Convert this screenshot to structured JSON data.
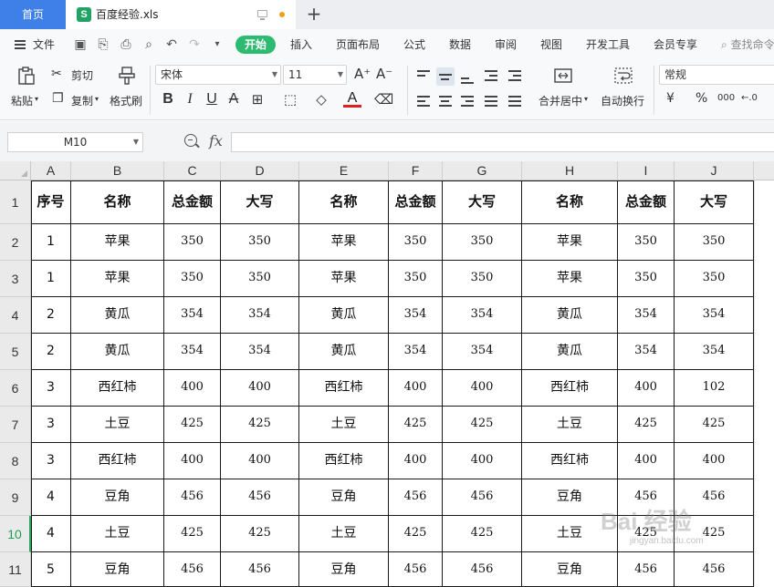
{
  "titlebar": {
    "home_tab": "首页",
    "file_tab": "百度经验.xls",
    "file_icon_letter": "S",
    "new_tab": "+",
    "accent": "#3f7fe8",
    "modified_dot_color": "#f0a020"
  },
  "menu": {
    "file_label": "文件",
    "tabs": [
      "开始",
      "插入",
      "页面布局",
      "公式",
      "数据",
      "审阅",
      "视图",
      "开发工具",
      "会员专享"
    ],
    "active_tab": "开始",
    "active_color": "#2dbb71",
    "search_label": "查找命令"
  },
  "ribbon": {
    "paste": "粘贴",
    "cut": "剪切",
    "copy": "复制",
    "format_painter": "格式刷",
    "font_name": "宋体",
    "font_size": "11",
    "merge_center": "合并居中",
    "wrap_text": "自动换行",
    "number_format": "常规",
    "font_grow": "A⁺",
    "font_shrink": "A⁻",
    "bold": "B",
    "italic": "I",
    "underline": "U",
    "strike": "A",
    "font_color_letter": "A",
    "font_color": "#e02020",
    "currency": "¥",
    "percent": "%",
    "thousands": "000",
    "dec_inc": "←.0"
  },
  "formula_bar": {
    "cell_ref": "M10",
    "fx": "fx",
    "formula": ""
  },
  "sheet": {
    "columns": [
      "A",
      "B",
      "C",
      "D",
      "E",
      "F",
      "G",
      "H",
      "I",
      "J"
    ],
    "row_numbers": [
      "1",
      "2",
      "3",
      "4",
      "5",
      "6",
      "7",
      "8",
      "9",
      "10",
      "11"
    ],
    "active_row": "10",
    "header_row": [
      "序号",
      "名称",
      "总金额",
      "大写",
      "名称",
      "总金额",
      "大写",
      "名称",
      "总金额",
      "大写"
    ],
    "rows": [
      [
        "1",
        "苹果",
        "350",
        "350",
        "苹果",
        "350",
        "350",
        "苹果",
        "350",
        "350"
      ],
      [
        "1",
        "苹果",
        "350",
        "350",
        "苹果",
        "350",
        "350",
        "苹果",
        "350",
        "350"
      ],
      [
        "2",
        "黄瓜",
        "354",
        "354",
        "黄瓜",
        "354",
        "354",
        "黄瓜",
        "354",
        "354"
      ],
      [
        "2",
        "黄瓜",
        "354",
        "354",
        "黄瓜",
        "354",
        "354",
        "黄瓜",
        "354",
        "354"
      ],
      [
        "3",
        "西红柿",
        "400",
        "400",
        "西红柿",
        "400",
        "400",
        "西红柿",
        "400",
        "102"
      ],
      [
        "3",
        "土豆",
        "425",
        "425",
        "土豆",
        "425",
        "425",
        "土豆",
        "425",
        "425"
      ],
      [
        "3",
        "西红柿",
        "400",
        "400",
        "西红柿",
        "400",
        "400",
        "西红柿",
        "400",
        "400"
      ],
      [
        "4",
        "豆角",
        "456",
        "456",
        "豆角",
        "456",
        "456",
        "豆角",
        "456",
        "456"
      ],
      [
        "4",
        "土豆",
        "425",
        "425",
        "土豆",
        "425",
        "425",
        "土豆",
        "425",
        "425"
      ],
      [
        "5",
        "豆角",
        "456",
        "456",
        "豆角",
        "456",
        "456",
        "豆角",
        "456",
        "456"
      ]
    ]
  },
  "watermark": {
    "text": "Bai 经验",
    "sub": "jingyan.baidu.com"
  }
}
